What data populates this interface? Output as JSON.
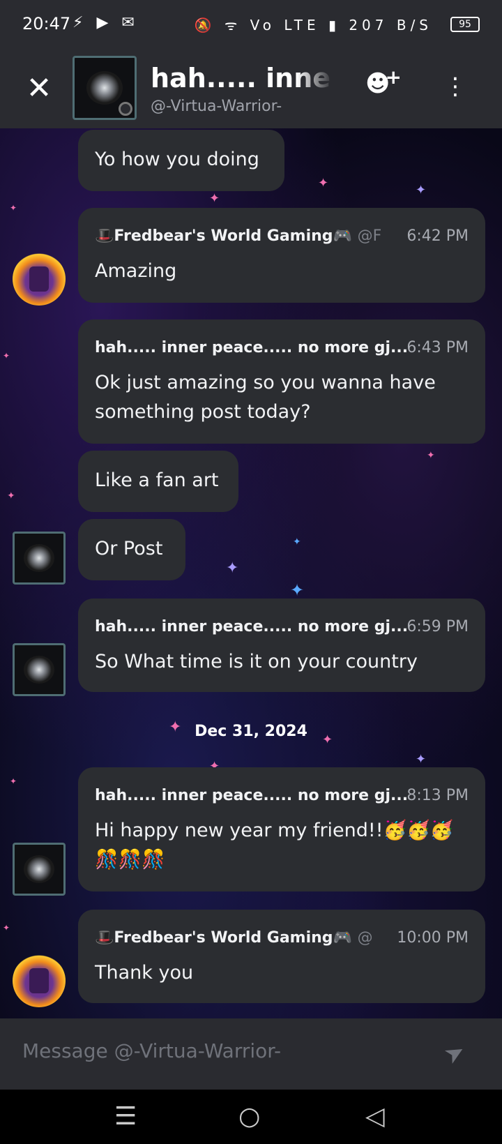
{
  "status_bar": {
    "time": "20:47",
    "left_icons": "⚡ ▶ ✉",
    "right_icons": "🔕 ᯤ Vo LTE ▮ 207 B/S",
    "battery": "95"
  },
  "header": {
    "title": "hah..... inner peace..... no more gj...",
    "subtitle": "@-Virtua-Warrior-"
  },
  "messages": [
    {
      "text": "Yo how you doing"
    },
    {
      "author": "🎩Fredbear's World Gaming🎮",
      "handle": "@F",
      "time": "6:42 PM",
      "text": "Amazing"
    },
    {
      "author": "hah..... inner peace..... no more gj...",
      "time": "6:43 PM",
      "text": "Ok just amazing so you wanna have",
      "text2": "something post today?"
    },
    {
      "text": "Like a fan art"
    },
    {
      "text": "Or Post"
    },
    {
      "author": "hah..... inner peace..... no more gj...",
      "time": "6:59 PM",
      "text": "So What time is it on your country"
    },
    {
      "author": "hah..... inner peace..... no more gj...",
      "time": "8:13 PM",
      "text": "Hi happy new year my friend!!🥳🥳🥳",
      "text2": "🎊🎊🎊"
    },
    {
      "author": "🎩Fredbear's World Gaming🎮",
      "handle": "@",
      "time": "10:00 PM",
      "text": "Thank you"
    }
  ],
  "date_divider": "Dec 31, 2024",
  "composer": {
    "placeholder": "Message @-Virtua-Warrior-"
  },
  "nav": {
    "menu": "☰",
    "home": "○",
    "back": "◁"
  },
  "colors": {
    "bubble": "#2b2d31",
    "header": "#2a2b30",
    "accent_star": "#f06fb0"
  }
}
